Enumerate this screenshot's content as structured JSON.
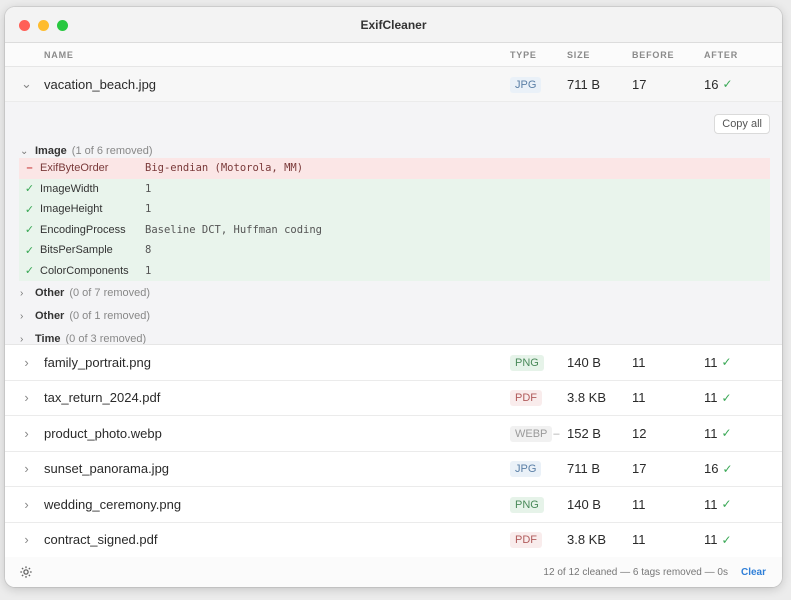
{
  "window": {
    "title": "ExifCleaner"
  },
  "columns": {
    "name": "NAME",
    "type": "TYPE",
    "size": "SIZE",
    "before": "BEFORE",
    "after": "AFTER"
  },
  "files": [
    {
      "name": "vacation_beach.jpg",
      "type": "JPG",
      "size": "711 B",
      "before": "17",
      "after": "16"
    },
    {
      "name": "family_portrait.png",
      "type": "PNG",
      "size": "140 B",
      "before": "11",
      "after": "11"
    },
    {
      "name": "tax_return_2024.pdf",
      "type": "PDF",
      "size": "3.8 KB",
      "before": "11",
      "after": "11"
    },
    {
      "name": "product_photo.webp",
      "type": "WEBP",
      "size": "152 B",
      "before": "12",
      "after": "11"
    },
    {
      "name": "sunset_panorama.jpg",
      "type": "JPG",
      "size": "711 B",
      "before": "17",
      "after": "16"
    },
    {
      "name": "wedding_ceremony.png",
      "type": "PNG",
      "size": "140 B",
      "before": "11",
      "after": "11"
    },
    {
      "name": "contract_signed.pdf",
      "type": "PDF",
      "size": "3.8 KB",
      "before": "11",
      "after": "11"
    }
  ],
  "detail": {
    "copy_all": "Copy all",
    "groups": [
      {
        "name": "Image",
        "summary": "(1 of 6 removed)"
      },
      {
        "name": "Other",
        "summary": "(0 of 7 removed)"
      },
      {
        "name": "Other",
        "summary": "(0 of 1 removed)"
      },
      {
        "name": "Time",
        "summary": "(0 of 3 removed)"
      }
    ],
    "tags": [
      {
        "mark": "–",
        "name": "ExifByteOrder",
        "value": "Big-endian (Motorola, MM)",
        "status": "removed"
      },
      {
        "mark": "✓",
        "name": "ImageWidth",
        "value": "1",
        "status": "kept"
      },
      {
        "mark": "✓",
        "name": "ImageHeight",
        "value": "1",
        "status": "kept"
      },
      {
        "mark": "✓",
        "name": "EncodingProcess",
        "value": "Baseline DCT, Huffman coding",
        "status": "kept"
      },
      {
        "mark": "✓",
        "name": "BitsPerSample",
        "value": "8",
        "status": "kept"
      },
      {
        "mark": "✓",
        "name": "ColorComponents",
        "value": "1",
        "status": "kept"
      }
    ]
  },
  "footer": {
    "status": "12 of 12 cleaned — 6 tags removed — 0s",
    "clear": "Clear"
  },
  "icons": {
    "expanded": "chevron-down-icon",
    "collapsed": "chevron-right-icon",
    "check": "check-icon",
    "settings": "gear-icon"
  },
  "colors": {
    "accent": "#2f7fd8",
    "success": "#3aa856",
    "removed_bg": "#fbe6e6",
    "kept_bg": "#e9f4ec"
  }
}
